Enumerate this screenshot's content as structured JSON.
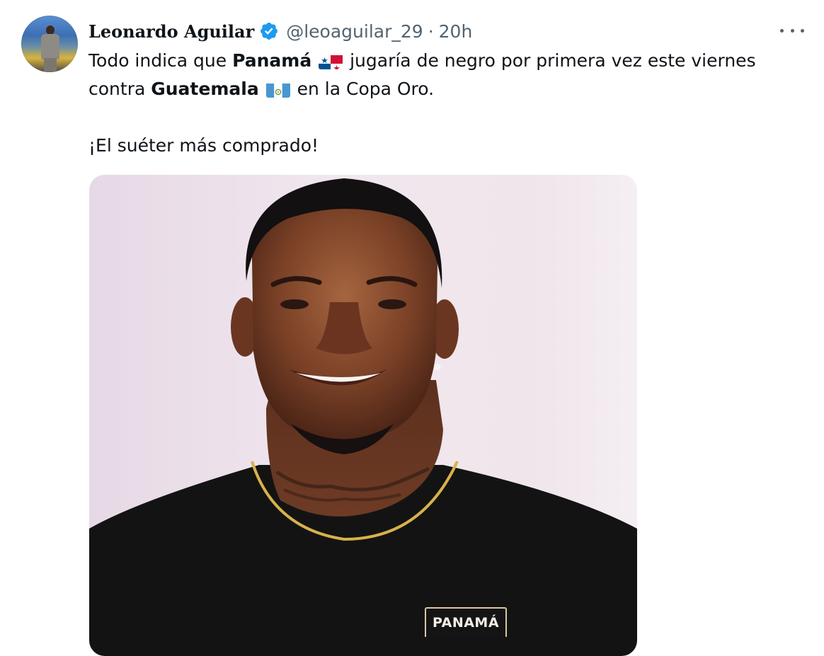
{
  "tweet": {
    "author_name": "Leonardo Aguilar",
    "handle": "@leoaguilar_29",
    "separator": "·",
    "time": "20h",
    "text": {
      "line1_pre": "Todo indica que ",
      "line1_bold": "Panamá",
      "line1_post": " jugaría de negro por primera vez este viernes",
      "line2_pre": "contra ",
      "line2_bold": "Guatemala",
      "line2_post": " en la Copa Oro.",
      "line3": "¡El suéter más comprado!"
    },
    "media": {
      "jersey_text": "PANAMÁ"
    }
  },
  "icons": {
    "verified": "verified-badge-icon",
    "more": "more-horizontal-icon",
    "flag_panama": "flag-panama-icon",
    "flag_guatemala": "flag-guatemala-icon"
  },
  "colors": {
    "verified_blue": "#1d9bf0",
    "secondary_text": "#536471",
    "primary_text": "#0f1419"
  }
}
